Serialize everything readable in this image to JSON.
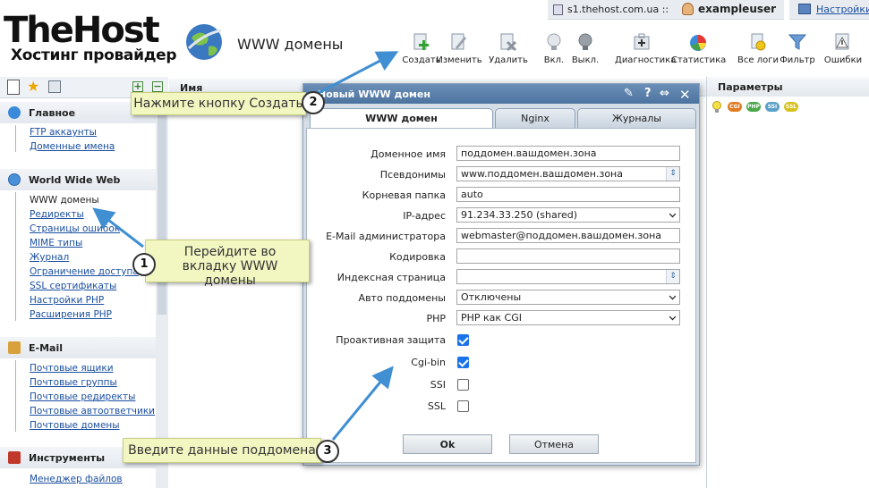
{
  "topbar": {
    "server": "s1.thehost.com.ua ::",
    "username": "exampleuser",
    "settings": "Настройки"
  },
  "logo": {
    "main": "TheHost",
    "sub": "Хостинг провайдер"
  },
  "page_title": "WWW домены",
  "toolbar": [
    {
      "label": "Создать",
      "icon": "create-icon"
    },
    {
      "label": "Изменить",
      "icon": "edit-icon"
    },
    {
      "label": "Удалить",
      "icon": "delete-icon"
    },
    {
      "label": "Вкл.",
      "icon": "bulb-on-icon"
    },
    {
      "label": "Выкл.",
      "icon": "bulb-off-icon"
    },
    {
      "label": "Диагностика",
      "icon": "diagnostics-icon"
    },
    {
      "label": "Статистика",
      "icon": "statistics-icon"
    },
    {
      "label": "Все логи",
      "icon": "logs-icon"
    },
    {
      "label": "Фильтр",
      "icon": "filter-icon"
    },
    {
      "label": "Ошибки",
      "icon": "errors-icon"
    }
  ],
  "sidebar": {
    "sections": [
      {
        "title": "Главное",
        "items": [
          "FTP аккаунты",
          "Доменные имена"
        ]
      },
      {
        "title": "World Wide Web",
        "items": [
          "WWW домены",
          "Редиректы",
          "Страницы ошибок",
          "MIME типы",
          "Журнал",
          "Ограничение доступа",
          "SSL сертификаты",
          "Настройки PHP",
          "Расширения PHP"
        ]
      },
      {
        "title": "E-Mail",
        "items": [
          "Почтовые ящики",
          "Почтовые группы",
          "Почтовые редиректы",
          "Почтовые автоответчики",
          "Почтовые домены"
        ]
      },
      {
        "title": "Инструменты",
        "items": [
          "Менеджер файлов"
        ]
      }
    ]
  },
  "grid": {
    "col_name": "Имя"
  },
  "params": {
    "title": "Параметры",
    "badges": [
      "CGI",
      "PHP",
      "SSI",
      "SSL"
    ]
  },
  "dialog": {
    "title": "Новый WWW домен",
    "tabs": [
      "WWW домен",
      "Nginx",
      "Журналы"
    ],
    "fields": [
      {
        "label": "Доменное имя",
        "value": "поддомен.вашдомен.зона",
        "kind": "text"
      },
      {
        "label": "Псевдонимы",
        "value": "www.поддомен.вашдомен.зона",
        "kind": "spin"
      },
      {
        "label": "Корневая папка",
        "value": "auto",
        "kind": "text"
      },
      {
        "label": "IP-адрес",
        "value": "91.234.33.250 (shared)",
        "kind": "select"
      },
      {
        "label": "E-Mail администратора",
        "value": "webmaster@поддомен.вашдомен.зона",
        "kind": "text"
      },
      {
        "label": "Кодировка",
        "value": "",
        "kind": "text"
      },
      {
        "label": "Индексная страница",
        "value": "",
        "kind": "spin"
      },
      {
        "label": "Авто поддомены",
        "value": "Отключены",
        "kind": "select"
      },
      {
        "label": "PHP",
        "value": "PHP как CGI",
        "kind": "select"
      }
    ],
    "checks": [
      {
        "label": "Проактивная защита",
        "checked": true
      },
      {
        "label": "Cgi-bin",
        "checked": true
      },
      {
        "label": "SSI",
        "checked": false
      },
      {
        "label": "SSL",
        "checked": false
      }
    ],
    "ok": "Ok",
    "cancel": "Отмена"
  },
  "callouts": [
    {
      "num": "1",
      "text": "Перейдите во вкладку WWW домены"
    },
    {
      "num": "2",
      "text": "Нажмите кнопку Создать"
    },
    {
      "num": "3",
      "text": "Введите данные поддомена"
    }
  ],
  "colors": {
    "accent": "#4c739f",
    "callout": "#f2f7c2",
    "arrow": "#3f8fd2",
    "link": "#1a4fa0"
  }
}
